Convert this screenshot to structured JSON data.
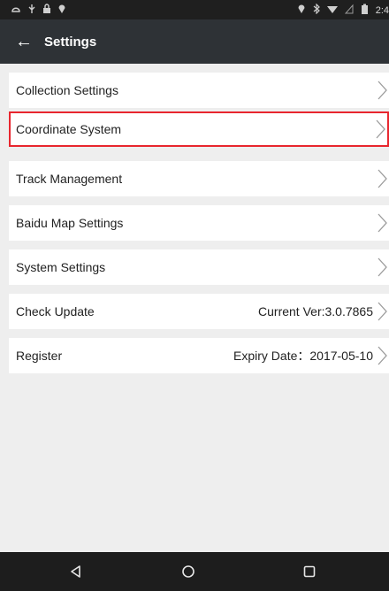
{
  "statusbar": {
    "left_icons": [
      "notification-icon",
      "usb-icon",
      "lock-icon",
      "location-pin-icon"
    ],
    "right_icons": [
      "location-icon",
      "bluetooth-icon",
      "wifi-icon",
      "signal-icon",
      "battery-icon"
    ],
    "time": "2:4"
  },
  "appbar": {
    "back_icon": "←",
    "title": "Settings"
  },
  "settings": {
    "items": [
      {
        "label": "Collection Settings",
        "value": ""
      },
      {
        "label": "Coordinate System",
        "value": ""
      },
      {
        "label": "Track Management",
        "value": ""
      },
      {
        "label": "Baidu Map Settings",
        "value": ""
      },
      {
        "label": "System Settings",
        "value": ""
      },
      {
        "label": "Check Update",
        "value": "Current Ver:3.0.7865"
      },
      {
        "label": "Register",
        "value": "Expiry Date：2017-05-10"
      }
    ],
    "highlight_color": "#e8262e"
  },
  "navbar": {
    "icons": [
      "back-triangle-icon",
      "home-circle-icon",
      "recents-square-icon"
    ]
  }
}
